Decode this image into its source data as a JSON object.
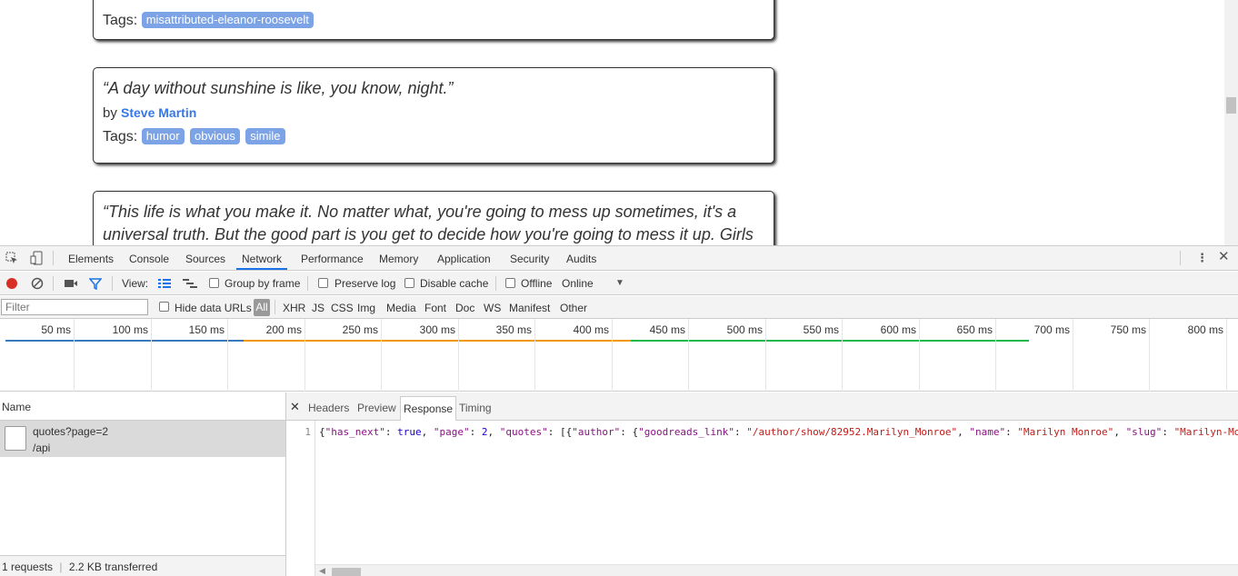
{
  "page": {
    "quote1": {
      "tags_label": "Tags:",
      "tags": [
        "misattributed-eleanor-roosevelt"
      ]
    },
    "quote2": {
      "text": "“A day without sunshine is like, you know, night.”",
      "by_label": "by",
      "author": "Steve Martin",
      "tags_label": "Tags:",
      "tags": [
        "humor",
        "obvious",
        "simile"
      ]
    },
    "quote3": {
      "line1": "“This life is what you make it. No matter what, you're going to mess up sometimes, it's a",
      "line2": "universal truth. But the good part is you get to decide how you're going to mess it up. Girls"
    }
  },
  "devtools": {
    "tabs": [
      "Elements",
      "Console",
      "Sources",
      "Network",
      "Performance",
      "Memory",
      "Application",
      "Security",
      "Audits"
    ],
    "active_tab": "Network",
    "toolbar": {
      "view_label": "View:",
      "group_by_frame": "Group by frame",
      "preserve_log": "Preserve log",
      "disable_cache": "Disable cache",
      "offline": "Offline",
      "throttle": "Online"
    },
    "filter": {
      "placeholder": "Filter",
      "hide_data_urls": "Hide data URLs",
      "types": [
        "All",
        "XHR",
        "JS",
        "CSS",
        "Img",
        "Media",
        "Font",
        "Doc",
        "WS",
        "Manifest",
        "Other"
      ],
      "active_type": "All"
    },
    "timeline_labels": [
      "50 ms",
      "100 ms",
      "150 ms",
      "200 ms",
      "250 ms",
      "300 ms",
      "350 ms",
      "400 ms",
      "450 ms",
      "500 ms",
      "550 ms",
      "600 ms",
      "650 ms",
      "700 ms",
      "750 ms",
      "800 ms"
    ],
    "name_header": "Name",
    "request": {
      "name": "quotes?page=2",
      "path": "/api"
    },
    "status": {
      "requests": "1 requests",
      "transferred": "2.2 KB transferred"
    },
    "detail_tabs": [
      "Headers",
      "Preview",
      "Response",
      "Timing"
    ],
    "active_detail_tab": "Response",
    "response": {
      "line_number": "1",
      "tokens": [
        {
          "t": "{",
          "c": ""
        },
        {
          "t": "\"has_next\"",
          "c": "k"
        },
        {
          "t": ": ",
          "c": ""
        },
        {
          "t": "true",
          "c": "b"
        },
        {
          "t": ", ",
          "c": ""
        },
        {
          "t": "\"page\"",
          "c": "k"
        },
        {
          "t": ": ",
          "c": ""
        },
        {
          "t": "2",
          "c": "n"
        },
        {
          "t": ", ",
          "c": ""
        },
        {
          "t": "\"quotes\"",
          "c": "k"
        },
        {
          "t": ": [{",
          "c": ""
        },
        {
          "t": "\"author\"",
          "c": "k"
        },
        {
          "t": ": {",
          "c": ""
        },
        {
          "t": "\"goodreads_link\"",
          "c": "k"
        },
        {
          "t": ": ",
          "c": ""
        },
        {
          "t": "\"/author/show/82952.Marilyn_Monroe\"",
          "c": "s"
        },
        {
          "t": ", ",
          "c": ""
        },
        {
          "t": "\"name\"",
          "c": "k"
        },
        {
          "t": ": ",
          "c": ""
        },
        {
          "t": "\"Marilyn Monroe\"",
          "c": "s"
        },
        {
          "t": ", ",
          "c": ""
        },
        {
          "t": "\"slug\"",
          "c": "k"
        },
        {
          "t": ": ",
          "c": ""
        },
        {
          "t": "\"Marilyn-Monroe\"",
          "c": "s"
        }
      ]
    }
  },
  "colors": {
    "accent": "#1a73e8",
    "tag_bg": "#7ca3e6",
    "author_link": "#3677e8",
    "record": "#d93025"
  }
}
